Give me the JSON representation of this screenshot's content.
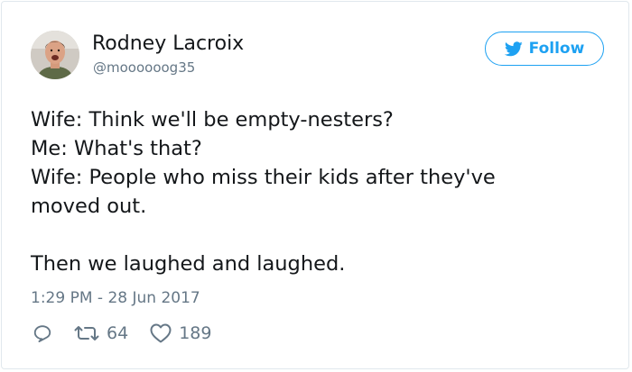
{
  "user": {
    "name": "Rodney Lacroix",
    "handle": "@moooooog35"
  },
  "follow_button": {
    "label": "Follow",
    "icon": "twitter-bird-icon"
  },
  "tweet": {
    "lines": [
      "Wife: Think we'll be empty-nesters?",
      "Me: What's that?",
      "Wife: People who miss their kids after they've",
      "moved out."
    ],
    "closing": "Then we laughed and laughed."
  },
  "timestamp": "1:29 PM - 28 Jun 2017",
  "actions": {
    "reply_icon": "reply-icon",
    "retweet_icon": "retweet-icon",
    "retweet_count": "64",
    "like_icon": "heart-icon",
    "like_count": "189"
  },
  "colors": {
    "accent": "#1da1f2",
    "text": "#14171a",
    "muted": "#657786",
    "border": "#e1e8ed"
  }
}
